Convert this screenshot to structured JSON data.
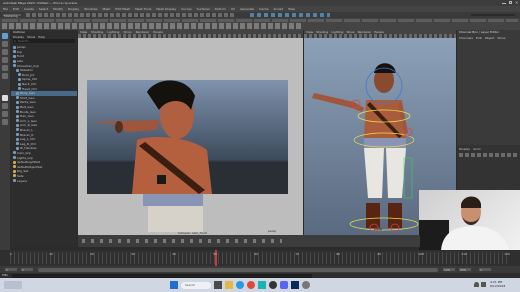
{
  "app": {
    "title": "Autodesk Maya 2024: Untitled — Prince rig scene",
    "menus": [
      "File",
      "Edit",
      "Create",
      "Select",
      "Modify",
      "Display",
      "Windows",
      "Mesh",
      "Edit Mesh",
      "Mesh Tools",
      "Mesh Display",
      "Curves",
      "Surfaces",
      "Deform",
      "UV",
      "Generate",
      "Cache",
      "Arnold",
      "Help"
    ],
    "workspace": "Modeling",
    "colors": {
      "bg": "#2b2b2b",
      "panel": "#444444",
      "accent": "#5ea1d6",
      "selected": "#4a6a8a",
      "timeline_key": "#c43c3c"
    }
  },
  "outliner": {
    "title": "Outliner",
    "menus": [
      "Display",
      "Show",
      "Help"
    ],
    "search_placeholder": "Search...",
    "items": [
      "persp",
      "top",
      "front",
      "side",
      "Character_Grp",
      "Skeleton",
      "Root_Jnt",
      "Spine_Ctrl",
      "Neck_Ctrl",
      "Head_Ctrl",
      "Body_Geo",
      "Shirt_Geo",
      "Pants_Geo",
      "Belt_Geo",
      "Boots_Geo",
      "Hair_Geo",
      "Arm_L_Geo",
      "Arm_R_Geo",
      "Bracer_L",
      "Bracer_R",
      "Leg_L_Ctrl",
      "Leg_R_Ctrl",
      "IK_Handles",
      "Cam_Grp",
      "Lights_Grp",
      "defaultLightSet",
      "defaultObjectSet",
      "Rig_Set",
      "Sets",
      "Layers"
    ]
  },
  "viewport_left": {
    "menus": [
      "View",
      "Shading",
      "Lighting",
      "Show",
      "Renderer",
      "Panels"
    ],
    "hud": "persp",
    "footer": "Camera: cam_front"
  },
  "viewport_right": {
    "menus": [
      "View",
      "Shading",
      "Lighting",
      "Show",
      "Renderer",
      "Panels"
    ],
    "label": "persp"
  },
  "right_panel": {
    "title": "Channel Box / Layer Editor",
    "tabs": [
      "Channels",
      "Edit",
      "Object",
      "Show"
    ],
    "layer_tabs": [
      "Display",
      "Anim"
    ]
  },
  "timeline": {
    "start": "1",
    "end": "120",
    "current": "1",
    "range_start": "1",
    "range_end": "200",
    "ticks": [
      "1",
      "10",
      "20",
      "30",
      "40",
      "50",
      "60",
      "70",
      "80",
      "90",
      "100",
      "110",
      "120"
    ]
  },
  "command_line": {
    "label": "MEL"
  },
  "taskbar": {
    "search_placeholder": "Search",
    "clock": "4:21 PM",
    "date": "6/12/2024"
  }
}
